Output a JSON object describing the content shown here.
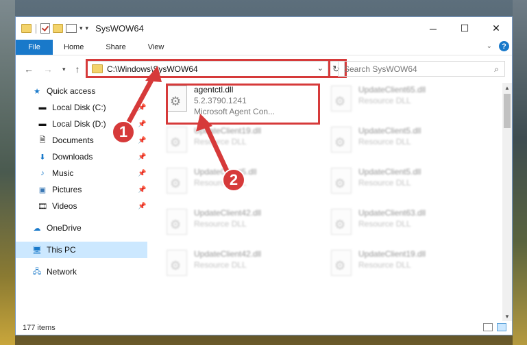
{
  "window": {
    "title": "SysWOW64",
    "minimize_glyph": "─",
    "maximize_glyph": "☐",
    "close_glyph": "✕"
  },
  "ribbon": {
    "tabs": [
      "File",
      "Home",
      "Share",
      "View"
    ],
    "help_glyph": "?"
  },
  "address": {
    "path": "C:\\Windows\\SysWOW64",
    "search_placeholder": "Search SysWOW64"
  },
  "sidebar": {
    "items": [
      {
        "label": "Quick access",
        "icon": "star-icon",
        "pinned": false
      },
      {
        "label": "Local Disk (C:)",
        "icon": "drive-icon",
        "pinned": true
      },
      {
        "label": "Local Disk (D:)",
        "icon": "drive-icon",
        "pinned": true
      },
      {
        "label": "Documents",
        "icon": "documents-icon",
        "pinned": true
      },
      {
        "label": "Downloads",
        "icon": "download-icon",
        "pinned": true
      },
      {
        "label": "Music",
        "icon": "music-icon",
        "pinned": true
      },
      {
        "label": "Pictures",
        "icon": "pictures-icon",
        "pinned": true
      },
      {
        "label": "Videos",
        "icon": "videos-icon",
        "pinned": true
      },
      {
        "label": "OneDrive",
        "icon": "cloud-icon",
        "pinned": false
      },
      {
        "label": "This PC",
        "icon": "computer-icon",
        "pinned": false,
        "selected": true
      },
      {
        "label": "Network",
        "icon": "network-icon",
        "pinned": false
      }
    ]
  },
  "files": [
    {
      "name": "agentctl.dll",
      "version": "5.2.3790.1241",
      "desc": "Microsoft Agent Con...",
      "highlighted": true
    },
    {
      "name": "UpdateClient65.dll",
      "desc": "Resource DLL"
    },
    {
      "name": "UpdateClient19.dll",
      "desc": "Resource DLL"
    },
    {
      "name": "UpdateClient5.dll",
      "desc": "Resource DLL"
    },
    {
      "name": "UpdateClient5.dll",
      "desc": "Resource DLL"
    },
    {
      "name": "UpdateClient5.dll",
      "desc": "Resource DLL"
    },
    {
      "name": "UpdateClient42.dll",
      "desc": "Resource DLL"
    },
    {
      "name": "UpdateClient63.dll",
      "desc": "Resource DLL"
    },
    {
      "name": "UpdateClient42.dll",
      "desc": "Resource DLL"
    },
    {
      "name": "UpdateClient19.dll",
      "desc": "Resource DLL"
    }
  ],
  "status": {
    "item_count": "177 items"
  },
  "callouts": [
    "1",
    "2"
  ],
  "colors": {
    "accent": "#1979ca",
    "highlight": "#d63a3a",
    "selected_bg": "#cce8ff"
  }
}
